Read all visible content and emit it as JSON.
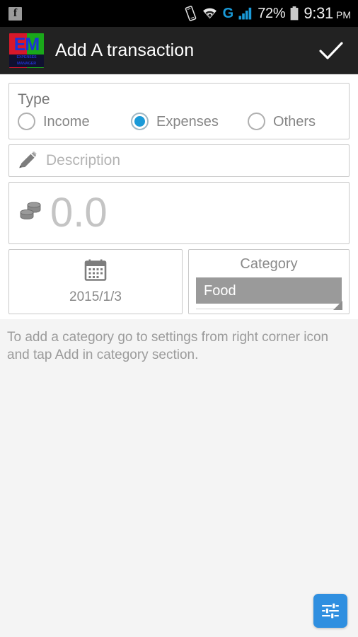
{
  "status_bar": {
    "notification_icon": "facebook-icon",
    "vibrate_icon": "vibrate-icon",
    "wifi_icon": "wifi-icon",
    "network_type": "G",
    "signal_icon": "signal-bars-icon",
    "battery_percent": "72%",
    "battery_icon": "battery-icon",
    "time": "9:31",
    "time_period": "PM"
  },
  "action_bar": {
    "logo_text": "EM",
    "logo_subtitle": "EXPENSES MANAGER",
    "title": "Add A transaction",
    "confirm_icon": "checkmark-icon"
  },
  "form": {
    "type": {
      "label": "Type",
      "options": [
        {
          "label": "Income",
          "selected": false
        },
        {
          "label": "Expenses",
          "selected": true
        },
        {
          "label": "Others",
          "selected": false
        }
      ]
    },
    "description": {
      "icon": "pencil-icon",
      "placeholder": "Description",
      "value": ""
    },
    "amount": {
      "icon": "coins-icon",
      "value": "0.0"
    },
    "date": {
      "icon": "calendar-icon",
      "value": "2015/1/3"
    },
    "category": {
      "label": "Category",
      "selected": "Food",
      "options": [
        "Food"
      ],
      "caret_icon": "spinner-caret-icon"
    }
  },
  "help": {
    "text": "To add a category go to settings from right corner icon and tap Add in category section."
  },
  "fab": {
    "icon": "sliders-settings-icon",
    "color": "#2f8fe0"
  },
  "colors": {
    "accent": "#1a9ad8",
    "action_bar_bg": "#222222",
    "status_bar_bg": "#000000",
    "page_bg": "#f4f4f4",
    "card_bg": "#ffffff",
    "spinner_bg": "#9a9a9a"
  }
}
